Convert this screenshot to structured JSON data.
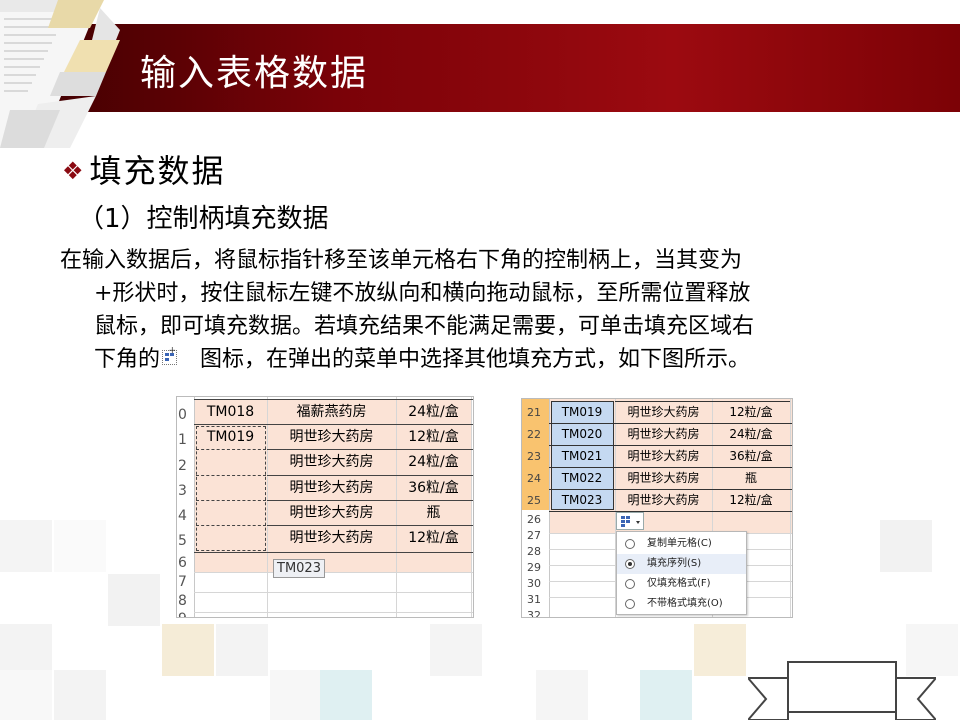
{
  "slide": {
    "title": "输入表格数据",
    "heading": "填充数据",
    "subheading": "（1）控制柄填充数据",
    "paragraph": {
      "line1": "在输入数据后，将鼠标指针移至该单元格右下角的控制柄上，当其变为",
      "line2": "+形状时，按住鼠标左键不放纵向和横向拖动鼠标，至所需位置释放",
      "line3": "鼠标，即可填充数据。若填充结果不能满足需要，可单击填充区域右",
      "line4a": "下角的",
      "line4b": "图标，在弹出的菜单中选择其他填充方式，如下图所示。"
    }
  },
  "left_sheet": {
    "row_numbers": [
      "0",
      "1",
      "2",
      "3",
      "4",
      "5",
      "6",
      "7",
      "8",
      "9"
    ],
    "rows": [
      {
        "code": "TM018",
        "name": "福薪燕药房",
        "spec": "24粒/盒"
      },
      {
        "code": "TM019",
        "name": "明世珍大药房",
        "spec": "12粒/盒"
      },
      {
        "code": "",
        "name": "明世珍大药房",
        "spec": "24粒/盒"
      },
      {
        "code": "",
        "name": "明世珍大药房",
        "spec": "36粒/盒"
      },
      {
        "code": "",
        "name": "明世珍大药房",
        "spec": "瓶"
      },
      {
        "code": "",
        "name": "明世珍大药房",
        "spec": "12粒/盒"
      }
    ],
    "tooltip": "TM023"
  },
  "right_sheet": {
    "row_numbers": [
      "21",
      "22",
      "23",
      "24",
      "25",
      "26",
      "27",
      "28",
      "29",
      "30",
      "31",
      "32"
    ],
    "rows": [
      {
        "code": "TM019",
        "name": "明世珍大药房",
        "spec": "12粒/盒"
      },
      {
        "code": "TM020",
        "name": "明世珍大药房",
        "spec": "24粒/盒"
      },
      {
        "code": "TM021",
        "name": "明世珍大药房",
        "spec": "36粒/盒"
      },
      {
        "code": "TM022",
        "name": "明世珍大药房",
        "spec": "瓶"
      },
      {
        "code": "TM023",
        "name": "明世珍大药房",
        "spec": "12粒/盒"
      }
    ],
    "menu": [
      {
        "label": "复制单元格(C)",
        "selected": false
      },
      {
        "label": "填充序列(S)",
        "selected": true
      },
      {
        "label": "仅填充格式(F)",
        "selected": false
      },
      {
        "label": "不带格式填充(O)",
        "selected": false
      }
    ]
  },
  "colors": {
    "header_red": "#8b0a12",
    "cell_pink": "#fbe3d6",
    "selected_blue": "#c5d9f1",
    "row_header_orange": "#f9c36f"
  }
}
